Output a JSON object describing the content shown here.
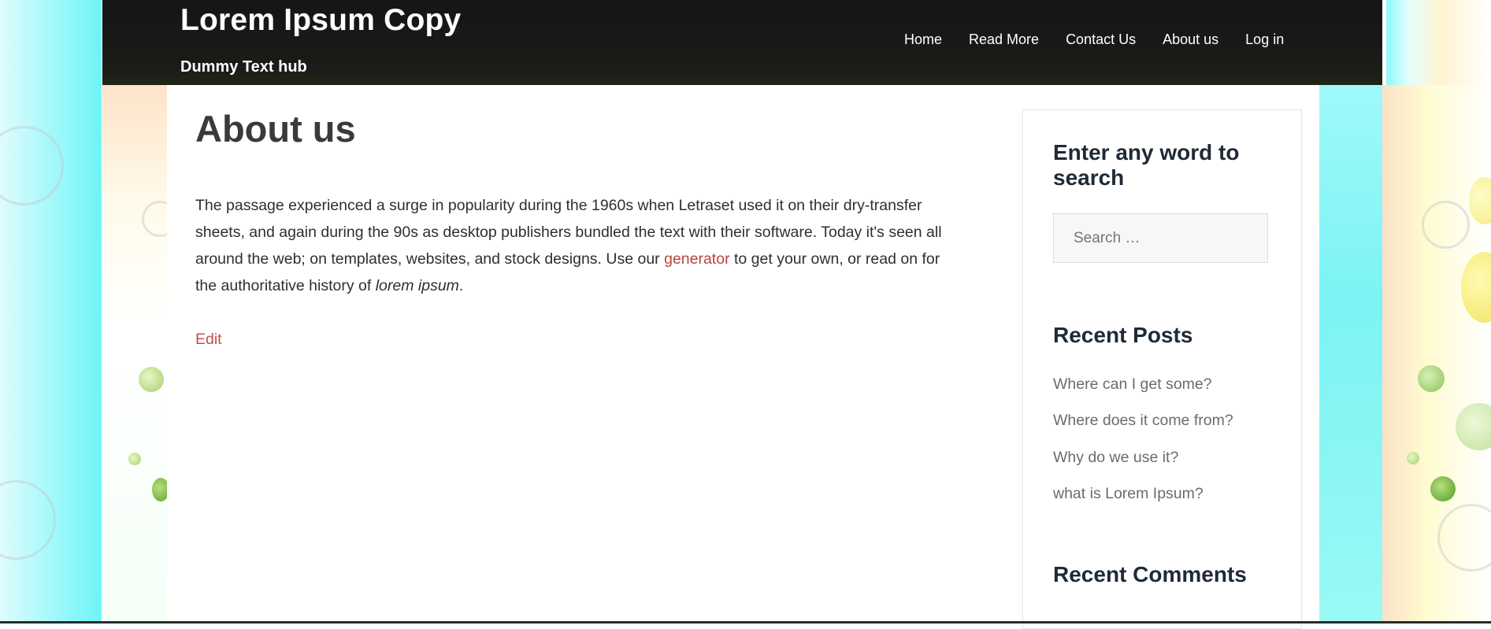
{
  "site": {
    "title": "Lorem Ipsum Copy",
    "tagline": "Dummy Text hub"
  },
  "nav": {
    "items": [
      "Home",
      "Read More",
      "Contact Us",
      "About us",
      "Log in"
    ]
  },
  "page": {
    "title": "About us",
    "body_part1": "The passage experienced a surge in popularity during the 1960s when Letraset used it on their dry-transfer sheets, and again during the 90s as desktop publishers bundled the text with their software. Today it's seen all around the web; on templates, websites, and stock designs. Use our ",
    "body_link": "generator",
    "body_part2": " to get your own, or read on for the authoritative history of ",
    "body_em": "lorem ipsum",
    "body_part3": ".",
    "edit_label": "Edit"
  },
  "sidebar": {
    "search_title": "Enter any word to search",
    "search_placeholder": "Search …",
    "recent_posts_title": "Recent Posts",
    "recent_posts": [
      "Where can I get some?",
      "Where does it come from?",
      "Why do we use it?",
      "what is Lorem Ipsum?"
    ],
    "recent_comments_title": "Recent Comments"
  },
  "colors": {
    "header_bg": "#151515",
    "link": "#b8453d",
    "heading": "#1f2a36"
  }
}
